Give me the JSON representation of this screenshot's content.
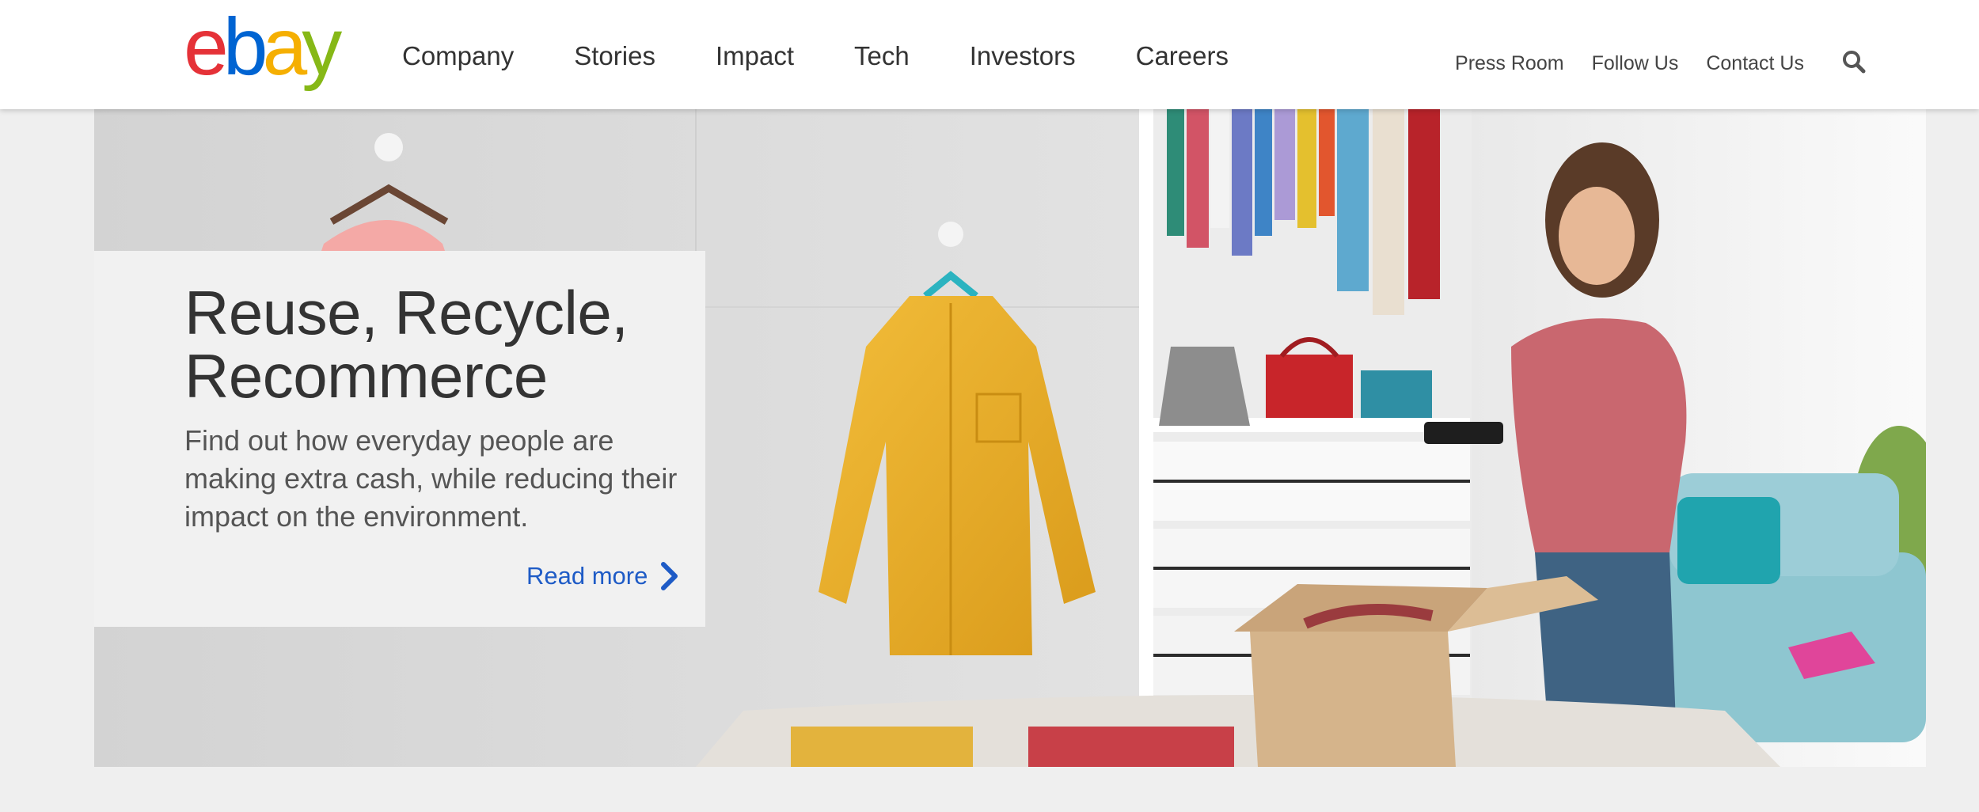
{
  "brand": {
    "letters": [
      "e",
      "b",
      "a",
      "y"
    ],
    "colors": [
      "#e53238",
      "#0064d2",
      "#f5af02",
      "#86b817"
    ]
  },
  "nav": {
    "items": [
      "Company",
      "Stories",
      "Impact",
      "Tech",
      "Investors",
      "Careers"
    ]
  },
  "utility": {
    "links": [
      "Press Room",
      "Follow Us",
      "Contact Us"
    ],
    "search_icon": "search-icon"
  },
  "hero": {
    "title": "Reuse, Recycle, Recommerce",
    "description": "Find out how everyday people are making extra cash, while reducing their impact on the environment.",
    "cta_label": "Read more",
    "cta_icon": "chevron-right-icon",
    "accent_color": "#1e5bc6"
  }
}
